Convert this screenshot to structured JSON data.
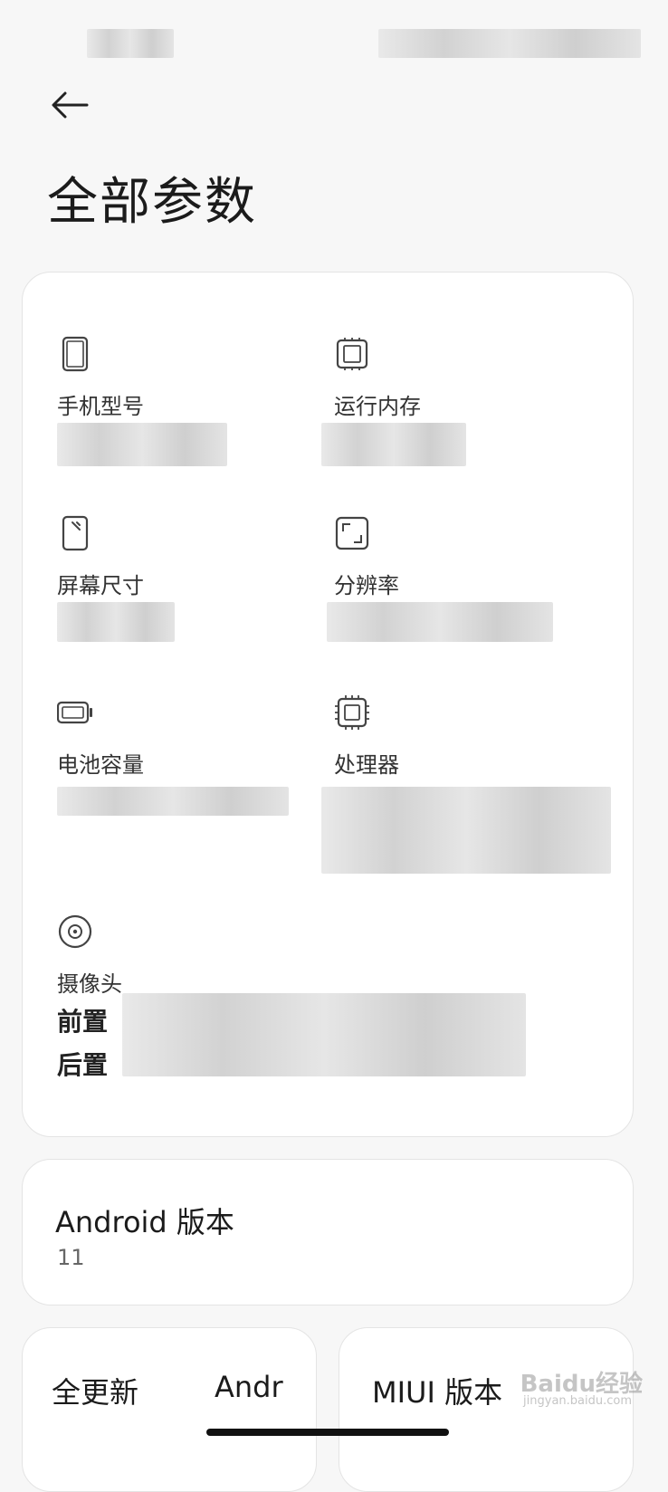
{
  "page": {
    "title": "全部参数"
  },
  "specs": [
    {
      "icon": "phone-icon",
      "label": "手机型号"
    },
    {
      "icon": "chip-icon",
      "label": "运行内存"
    },
    {
      "icon": "screen-size-icon",
      "label": "屏幕尺寸"
    },
    {
      "icon": "resolution-icon",
      "label": "分辨率"
    },
    {
      "icon": "battery-icon",
      "label": "电池容量"
    },
    {
      "icon": "processor-icon",
      "label": "处理器"
    },
    {
      "icon": "camera-icon",
      "label": "摄像头"
    }
  ],
  "camera": {
    "front_label": "前置",
    "rear_label": "后置"
  },
  "android": {
    "title": "Android 版本",
    "value": "11"
  },
  "bottom_cards": {
    "left_title": "全更新",
    "left_title_cut": "Andr",
    "right_title": "MIUI 版本"
  },
  "watermark": {
    "brand": "Baidu经验",
    "url": "jingyan.baidu.com"
  }
}
